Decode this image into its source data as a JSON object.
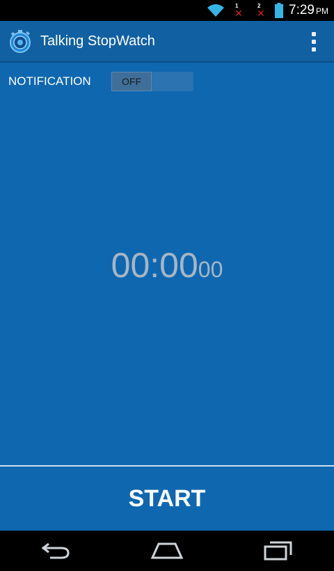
{
  "status_bar": {
    "sim1_label": "1",
    "sim2_label": "2",
    "sim_error_glyph": "✕",
    "time": "7:29",
    "ampm": "PM",
    "icons": [
      "wifi-icon",
      "sim1-no-signal-icon",
      "sim2-no-signal-icon",
      "battery-icon"
    ]
  },
  "app_bar": {
    "title": "Talking StopWatch",
    "icon": "stopwatch-icon",
    "menu_icon": "overflow-menu-icon"
  },
  "notification": {
    "label": "NOTIFICATION",
    "toggle_state": "OFF"
  },
  "timer": {
    "main": "00:00",
    "fraction": "00"
  },
  "start_button": {
    "label": "START"
  },
  "nav_bar": {
    "icons": [
      "back-icon",
      "home-icon",
      "recent-apps-icon"
    ]
  },
  "colors": {
    "background": "#0f67b0",
    "app_bar": "#1160a2",
    "timer_text": "#a8b6c4",
    "status_error": "#d42020"
  }
}
